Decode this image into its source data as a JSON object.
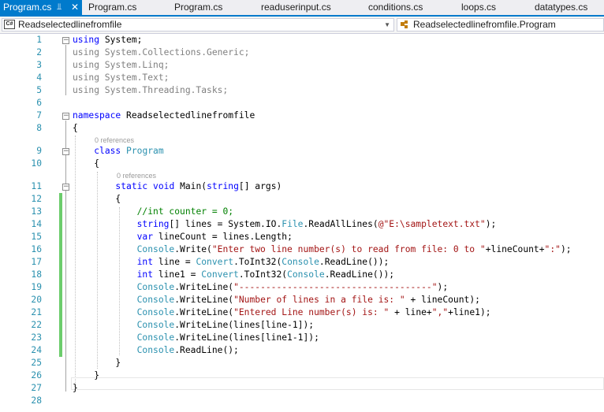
{
  "tabs": [
    {
      "label": "Program.cs",
      "active": true
    },
    {
      "label": "Program.cs"
    },
    {
      "label": "Program.cs"
    },
    {
      "label": "readuserinput.cs"
    },
    {
      "label": "conditions.cs"
    },
    {
      "label": "loops.cs"
    },
    {
      "label": "datatypes.cs"
    }
  ],
  "tab_pin_icon": "pin-icon",
  "tab_close_icon": "close-icon",
  "nav": {
    "project_badge": "C#",
    "project_selector": "Readselectedlinefromfile",
    "type_selector": "Readselectedlinefromfile.Program"
  },
  "codelens": {
    "class_refs": "0 references",
    "method_refs": "0 references"
  },
  "colors": {
    "accent": "#007acc",
    "keyword": "#0000ff",
    "type": "#2b91af",
    "string": "#a31515",
    "comment": "#008000",
    "changed_line": "#6ccc6c"
  },
  "code": [
    {
      "n": "1",
      "tokens": [
        [
          "kw",
          "using"
        ],
        [
          "pl",
          " System;"
        ]
      ]
    },
    {
      "n": "2",
      "tokens": [
        [
          "gr",
          "using System.Collections.Generic;"
        ]
      ]
    },
    {
      "n": "3",
      "tokens": [
        [
          "gr",
          "using System.Linq;"
        ]
      ]
    },
    {
      "n": "4",
      "tokens": [
        [
          "gr",
          "using System.Text;"
        ]
      ]
    },
    {
      "n": "5",
      "tokens": [
        [
          "gr",
          "using System.Threading.Tasks;"
        ]
      ]
    },
    {
      "n": "6",
      "tokens": []
    },
    {
      "n": "7",
      "tokens": [
        [
          "kw",
          "namespace"
        ],
        [
          "pl",
          " Readselectedlinefromfile"
        ]
      ]
    },
    {
      "n": "8",
      "tokens": [
        [
          "pl",
          "{"
        ]
      ]
    },
    {
      "n": "9",
      "tokens": [
        [
          "pl",
          "    "
        ],
        [
          "kw",
          "class"
        ],
        [
          "pl",
          " "
        ],
        [
          "ty",
          "Program"
        ]
      ]
    },
    {
      "n": "10",
      "tokens": [
        [
          "pl",
          "    {"
        ]
      ]
    },
    {
      "n": "11",
      "tokens": [
        [
          "pl",
          "        "
        ],
        [
          "kw",
          "static"
        ],
        [
          "pl",
          " "
        ],
        [
          "kw",
          "void"
        ],
        [
          "pl",
          " Main("
        ],
        [
          "kw",
          "string"
        ],
        [
          "pl",
          "[] args)"
        ]
      ]
    },
    {
      "n": "12",
      "tokens": [
        [
          "pl",
          "        {"
        ]
      ]
    },
    {
      "n": "13",
      "tokens": [
        [
          "pl",
          "            "
        ],
        [
          "cm",
          "//int counter = 0;"
        ]
      ]
    },
    {
      "n": "14",
      "tokens": [
        [
          "pl",
          "            "
        ],
        [
          "kw",
          "string"
        ],
        [
          "pl",
          "[] lines = System.IO."
        ],
        [
          "ty",
          "File"
        ],
        [
          "pl",
          ".ReadAllLines("
        ],
        [
          "st",
          "@\"E:\\sampletext.txt\""
        ],
        [
          "pl",
          ");"
        ]
      ]
    },
    {
      "n": "15",
      "tokens": [
        [
          "pl",
          "            "
        ],
        [
          "kw",
          "var"
        ],
        [
          "pl",
          " lineCount = lines.Length;"
        ]
      ]
    },
    {
      "n": "16",
      "tokens": [
        [
          "pl",
          "            "
        ],
        [
          "ty",
          "Console"
        ],
        [
          "pl",
          ".Write("
        ],
        [
          "st",
          "\"Enter two line number(s) to read from file: 0 to \""
        ],
        [
          "pl",
          "+lineCount+"
        ],
        [
          "st",
          "\":\""
        ],
        [
          "pl",
          ");"
        ]
      ]
    },
    {
      "n": "17",
      "tokens": [
        [
          "pl",
          "            "
        ],
        [
          "kw",
          "int"
        ],
        [
          "pl",
          " line = "
        ],
        [
          "ty",
          "Convert"
        ],
        [
          "pl",
          ".ToInt32("
        ],
        [
          "ty",
          "Console"
        ],
        [
          "pl",
          ".ReadLine());"
        ]
      ]
    },
    {
      "n": "18",
      "tokens": [
        [
          "pl",
          "            "
        ],
        [
          "kw",
          "int"
        ],
        [
          "pl",
          " line1 = "
        ],
        [
          "ty",
          "Convert"
        ],
        [
          "pl",
          ".ToInt32("
        ],
        [
          "ty",
          "Console"
        ],
        [
          "pl",
          ".ReadLine());"
        ]
      ]
    },
    {
      "n": "19",
      "tokens": [
        [
          "pl",
          "            "
        ],
        [
          "ty",
          "Console"
        ],
        [
          "pl",
          ".WriteLine("
        ],
        [
          "st",
          "\"------------------------------------\""
        ],
        [
          "pl",
          ");"
        ]
      ]
    },
    {
      "n": "20",
      "tokens": [
        [
          "pl",
          "            "
        ],
        [
          "ty",
          "Console"
        ],
        [
          "pl",
          ".WriteLine("
        ],
        [
          "st",
          "\"Number of lines in a file is: \""
        ],
        [
          "pl",
          " + lineCount);"
        ]
      ]
    },
    {
      "n": "21",
      "tokens": [
        [
          "pl",
          "            "
        ],
        [
          "ty",
          "Console"
        ],
        [
          "pl",
          ".WriteLine("
        ],
        [
          "st",
          "\"Entered Line number(s) is: \""
        ],
        [
          "pl",
          " + line+"
        ],
        [
          "st",
          "\",\""
        ],
        [
          "pl",
          "+line1);"
        ]
      ]
    },
    {
      "n": "22",
      "tokens": [
        [
          "pl",
          "            "
        ],
        [
          "ty",
          "Console"
        ],
        [
          "pl",
          ".WriteLine(lines[line-1]);"
        ]
      ]
    },
    {
      "n": "23",
      "tokens": [
        [
          "pl",
          "            "
        ],
        [
          "ty",
          "Console"
        ],
        [
          "pl",
          ".WriteLine(lines[line1-1]);"
        ]
      ]
    },
    {
      "n": "24",
      "tokens": [
        [
          "pl",
          "            "
        ],
        [
          "ty",
          "Console"
        ],
        [
          "pl",
          ".ReadLine();"
        ]
      ]
    },
    {
      "n": "25",
      "tokens": [
        [
          "pl",
          "        }"
        ]
      ]
    },
    {
      "n": "26",
      "tokens": [
        [
          "pl",
          "    }"
        ]
      ]
    },
    {
      "n": "27",
      "tokens": [
        [
          "pl",
          "}"
        ]
      ]
    },
    {
      "n": "28",
      "tokens": []
    }
  ]
}
